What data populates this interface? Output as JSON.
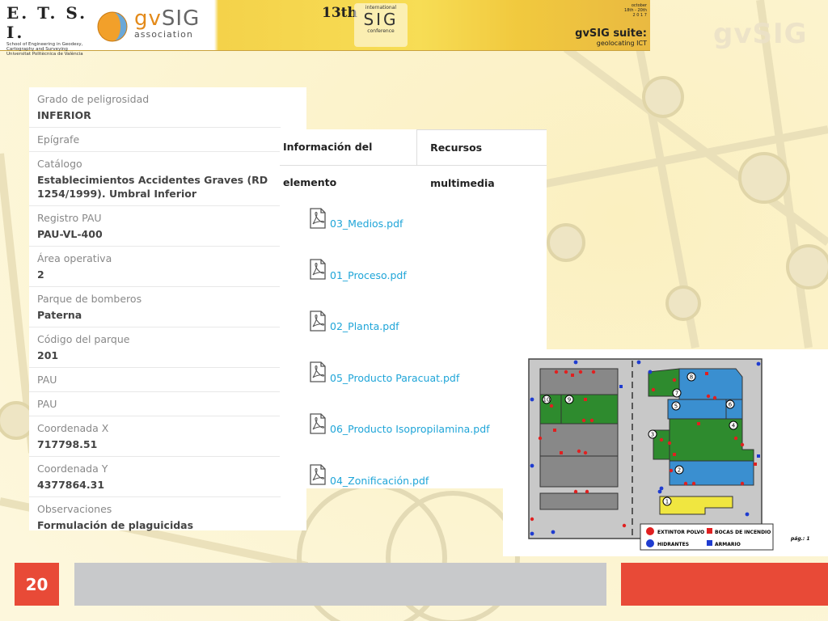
{
  "banner": {
    "etsi_title": "E. T. S. I.",
    "etsi_line1": "School of Engineering in Geodesy,",
    "etsi_line2": "Cartography and Surveying",
    "etsi_line3": "Universitat Politècnica de València",
    "gvsig_prefix": "gv",
    "gvsig_suffix": "SIG",
    "association": "association",
    "conf_number": "13th",
    "conf_international": "international",
    "conf_name": "SIG",
    "conf_word": "conference",
    "date_line1": "october",
    "date_line2": "18th - 20th",
    "date_line3": "2 0 1 7",
    "suite_title": "gvSIG suite:",
    "suite_sub": "geolocating ICT"
  },
  "watermark": "gvSIG",
  "attributes": [
    {
      "label": "Grado de peligrosidad",
      "value": "INFERIOR"
    },
    {
      "label": "Epígrafe",
      "value": ""
    },
    {
      "label": "Catálogo",
      "value": "Establecimientos Accidentes Graves (RD 1254/1999). Umbral Inferior"
    },
    {
      "label": "Registro PAU",
      "value": "PAU-VL-400"
    },
    {
      "label": "Área operativa",
      "value": "2"
    },
    {
      "label": "Parque de bomberos",
      "value": "Paterna"
    },
    {
      "label": "Código del parque",
      "value": "201"
    },
    {
      "label": "PAU",
      "value": ""
    },
    {
      "label": "PAU",
      "value": ""
    },
    {
      "label": "Coordenada X",
      "value": "717798.51"
    },
    {
      "label": "Coordenada Y",
      "value": "4377864.31"
    },
    {
      "label": "Observaciones",
      "value": "Formulación de plaguicidas"
    }
  ],
  "tabs": {
    "info": "Información del elemento",
    "multimedia": "Recursos multimedia"
  },
  "files": [
    "03_Medios.pdf",
    "01_Proceso.pdf",
    "02_Planta.pdf",
    "05_Producto Paracuat.pdf",
    "06_Producto Isopropilamina.pdf",
    "04_Zonificación.pdf"
  ],
  "map": {
    "legend_extintor": "EXTINTOR POLVO",
    "legend_bocas": "BOCAS DE INCENDIO",
    "legend_hidrantes": "HIDRANTES",
    "legend_armario": "ARMARIO",
    "page_label": "pág.: 1",
    "zones": [
      "1",
      "2",
      "3",
      "4",
      "5",
      "6",
      "7",
      "8",
      "9",
      "10"
    ]
  },
  "footer": {
    "page_number": "20"
  },
  "colors": {
    "accent_red": "#e84a37",
    "link_blue": "#1fa5d8",
    "zone_green": "#2e8b2e",
    "zone_blue": "#3a8fd0",
    "zone_yellow": "#f0e640"
  }
}
